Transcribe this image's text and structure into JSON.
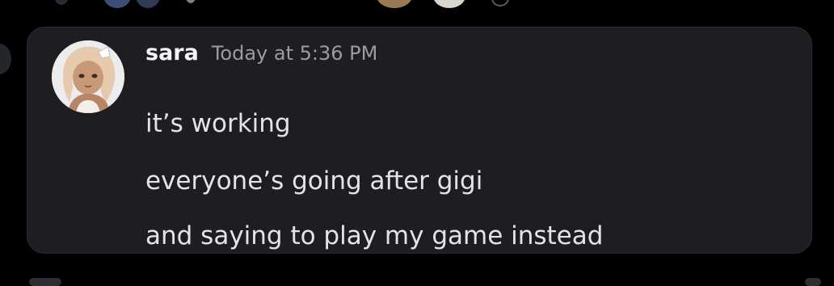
{
  "message": {
    "author": "sara",
    "timestamp": "Today at 5:36 PM",
    "avatar_icon": "avatar-portrait-icon",
    "lines": [
      "it’s working",
      "everyone’s going after gigi",
      "and saying to play my game instead"
    ]
  },
  "colors": {
    "background": "#000000",
    "card": "#1e1e22",
    "username": "#f2f3f5",
    "timestamp": "#9a9ca3",
    "text": "#e3e4e7"
  }
}
